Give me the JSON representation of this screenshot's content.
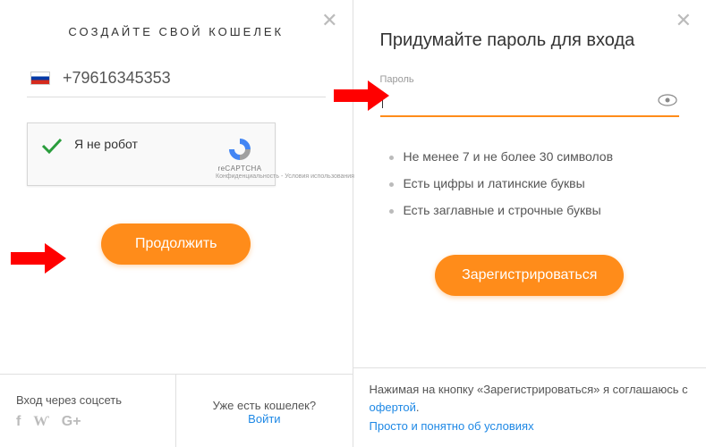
{
  "left": {
    "title": "СОЗДАЙТЕ СВОЙ КОШЕЛЕК",
    "phone": "+79616345353",
    "captcha": {
      "label": "Я не робот",
      "brand": "reCAPTCHA",
      "privacy": "Конфиденциальность",
      "terms": "Условия использования",
      "sep": " - "
    },
    "continue_btn": "Продолжить",
    "footer": {
      "social_title": "Вход через соцсеть",
      "have_wallet": "Уже есть кошелек?",
      "login": "Войти"
    }
  },
  "right": {
    "title": "Придумайте пароль для входа",
    "password_label": "Пароль",
    "requirements": [
      "Не менее 7 и не более 30 символов",
      "Есть цифры и латинские буквы",
      "Есть заглавные и строчные буквы"
    ],
    "register_btn": "Зарегистрироваться",
    "footer": {
      "line1_a": "Нажимая на кнопку «Зарегистрироваться» я соглашаюсь с ",
      "offer": "офертой",
      "dot": ".",
      "line2": "Просто и понятно об условиях"
    }
  }
}
